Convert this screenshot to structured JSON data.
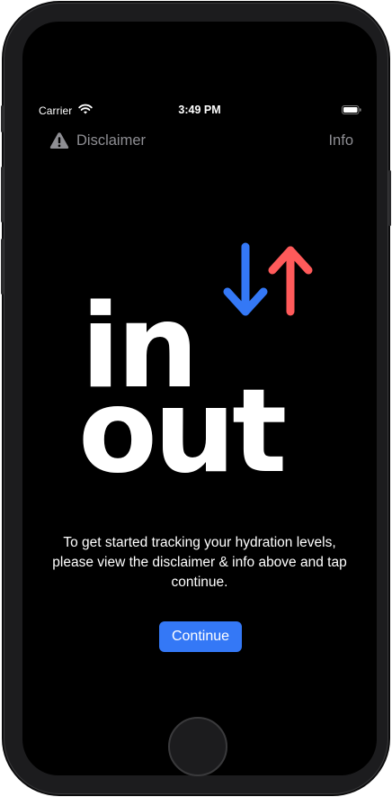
{
  "status_bar": {
    "carrier": "Carrier",
    "time": "3:49 PM",
    "wifi_icon": "wifi-icon",
    "battery_icon": "battery-full-icon"
  },
  "nav": {
    "left_icon": "warning-triangle-icon",
    "left_label": "Disclaimer",
    "right_label": "Info"
  },
  "logo": {
    "line1": "in",
    "line2": "out",
    "down_arrow_icon": "arrow-down-icon",
    "up_arrow_icon": "arrow-up-icon",
    "down_color": "#3478f6",
    "up_color": "#ff5a5a"
  },
  "message": "To get started tracking your hydration levels, please view the disclaimer & info above and tap continue.",
  "continue_label": "Continue",
  "colors": {
    "accent": "#3478f6",
    "background": "#000000",
    "nav_text": "#8e8e93"
  }
}
